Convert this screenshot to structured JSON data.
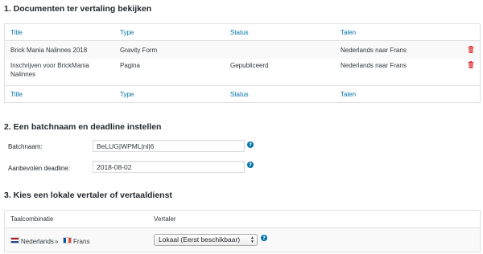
{
  "section1": {
    "title": "1. Documenten ter vertaling bekijken",
    "columns": [
      "Title",
      "Type",
      "Status",
      "Talen"
    ],
    "rows": [
      {
        "title": "Brick Mania Nalinnes 2018",
        "type": "Gravity Form",
        "status": "",
        "languages": "Nederlands naar Frans"
      },
      {
        "title": "Inschrijven voor BrickMania Nalinnes",
        "type": "Pagina",
        "status": "Gepubliceerd",
        "languages": "Nederlands naar Frans"
      }
    ]
  },
  "section2": {
    "title": "2. Een batchnaam en deadline instellen",
    "batch_label": "Batchnaam:",
    "batch_value": "BeLUG|WPML|nl|6",
    "deadline_label": "Aanbevolen deadline:",
    "deadline_value": "2018-08-02"
  },
  "section3": {
    "title": "3. Kies een lokale vertaler of vertaaldienst",
    "col_pair": "Taalcombinatie",
    "col_translator": "Vertaler",
    "source_lang": "Nederlands",
    "separator": "»",
    "target_lang": "Frans",
    "translator_selected": "Lokaal (Eerst beschikbaar)"
  },
  "icons": {
    "help": "help-icon",
    "trash": "trash-icon",
    "flag_nl": "flag-netherlands-icon",
    "flag_fr": "flag-france-icon"
  },
  "colors": {
    "link": "#0073aa",
    "trash": "#dc3232",
    "row_alt": "#f9f9f9"
  }
}
